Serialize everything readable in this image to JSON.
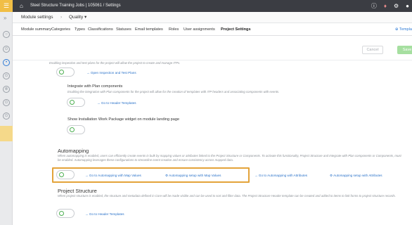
{
  "topbar": {
    "breadcrumb": "Steel Structure Training Jobs | 105061  /  Settings"
  },
  "subbar": {
    "module_settings": "Module settings",
    "quality": "Quality ▾"
  },
  "tabs": [
    {
      "label": "Module summary"
    },
    {
      "label": "Categories"
    },
    {
      "label": "Types"
    },
    {
      "label": "Classifications"
    },
    {
      "label": "Statuses"
    },
    {
      "label": "Email templates"
    },
    {
      "label": "Roles"
    },
    {
      "label": "User assignments"
    },
    {
      "label": "Project Settings"
    }
  ],
  "tab_right": "Templa",
  "actions": {
    "cancel": "Cancel",
    "save": "Save"
  },
  "sections": {
    "inspection": {
      "desc": "Enabling inspection and test plans for the project will allow the project to create and manage ITPs.",
      "link": "→ Open Inspection and Test Plans"
    },
    "plan_components": {
      "title": "Integrate with Plan components",
      "desc": "Enabling the integration with Plan components for the project will allow for the creation of templates with ITP headers and associating components with events.",
      "link": "→ Go to Header Templates"
    },
    "work_package": {
      "title": "Show Installation Work Package widget on module landing page"
    },
    "automapping": {
      "title": "Automapping",
      "desc": "When automapping is enabled, users can efficiently create events in bulk by mapping values or attributes linked to the Project Structure or Components. To activate this functionality, Project Structure and Integrate with Plan components or Components, must be enabled. Automapping leverages these configurations to streamline event creation and ensure consistency across mapped data.",
      "links": [
        "→ Go to Automapping with Map Values",
        "⚙ Automapping setup with Map Values",
        "→ Go to Automapping with Attributes",
        "⚙ Automapping setup with Attributes"
      ]
    },
    "project_structure": {
      "title": "Project Structure",
      "desc": "When project structure is enabled, the structure and metadata defined in Core will be made visible and can be used to sort and filter data. The Project Structure Header template can be created and added to items to link forms to project structure records.",
      "link": "→ Go to Header Templates"
    }
  },
  "colors": {
    "topbar": "#3b3d43",
    "accent_yellow": "#f1be45",
    "link": "#2a72c9",
    "toggle_knob": "#4caf50",
    "highlight": "#e3a33a"
  }
}
